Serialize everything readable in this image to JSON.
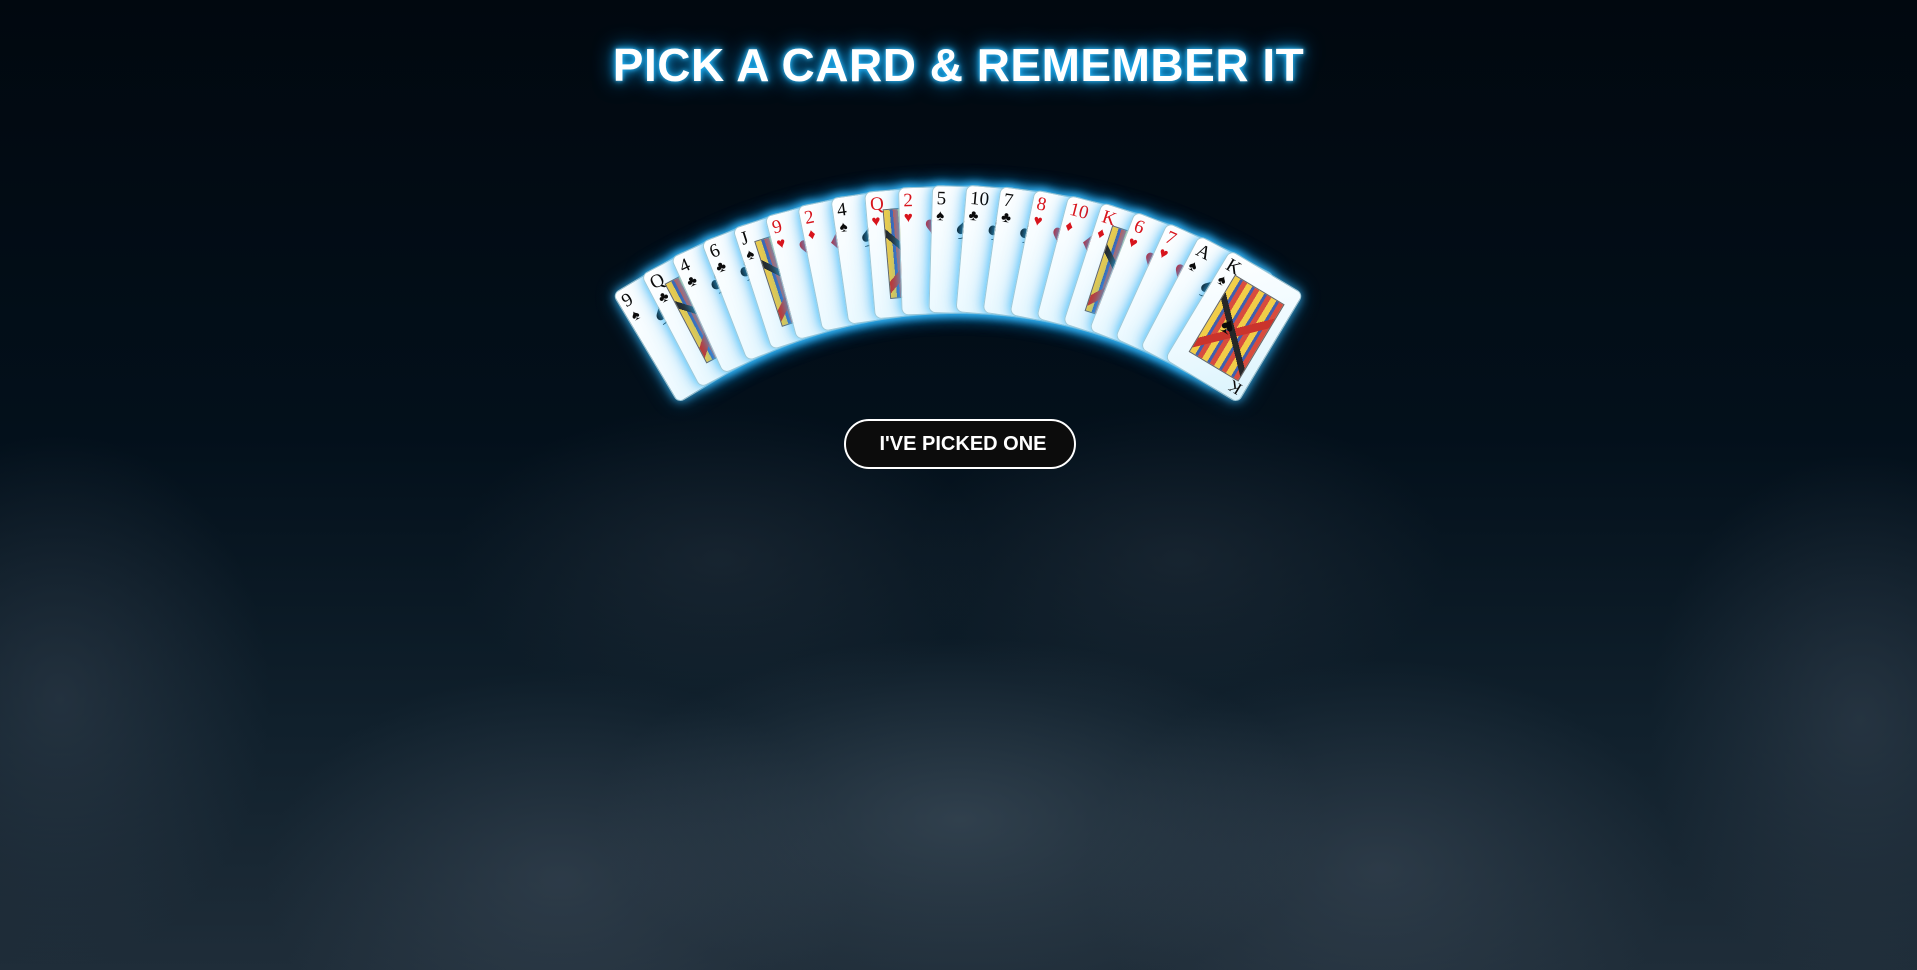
{
  "title": "PICK A CARD & REMEMBER IT",
  "button_label": "I'VE PICKED ONE",
  "colors": {
    "title_glow": "#19b7ff",
    "card_glow": "#3cbeff",
    "suit_red": "#d8141c",
    "suit_black": "#0b0b0b",
    "button_bg": "#0c0c0c",
    "button_border": "#ffffff"
  },
  "cards": [
    {
      "rank": "9",
      "suit": "♠",
      "color": "black",
      "face": false
    },
    {
      "rank": "Q",
      "suit": "♣",
      "color": "black",
      "face": true
    },
    {
      "rank": "4",
      "suit": "♣",
      "color": "black",
      "face": false
    },
    {
      "rank": "6",
      "suit": "♣",
      "color": "black",
      "face": false
    },
    {
      "rank": "J",
      "suit": "♠",
      "color": "black",
      "face": true
    },
    {
      "rank": "9",
      "suit": "♥",
      "color": "red",
      "face": false
    },
    {
      "rank": "2",
      "suit": "♦",
      "color": "red",
      "face": false
    },
    {
      "rank": "4",
      "suit": "♠",
      "color": "black",
      "face": false
    },
    {
      "rank": "Q",
      "suit": "♥",
      "color": "red",
      "face": true
    },
    {
      "rank": "2",
      "suit": "♥",
      "color": "red",
      "face": false
    },
    {
      "rank": "5",
      "suit": "♠",
      "color": "black",
      "face": false
    },
    {
      "rank": "10",
      "suit": "♣",
      "color": "black",
      "face": false
    },
    {
      "rank": "7",
      "suit": "♣",
      "color": "black",
      "face": false
    },
    {
      "rank": "8",
      "suit": "♥",
      "color": "red",
      "face": false
    },
    {
      "rank": "10",
      "suit": "♦",
      "color": "red",
      "face": false
    },
    {
      "rank": "K",
      "suit": "♦",
      "color": "red",
      "face": true
    },
    {
      "rank": "6",
      "suit": "♥",
      "color": "red",
      "face": false
    },
    {
      "rank": "7",
      "suit": "♥",
      "color": "red",
      "face": false
    },
    {
      "rank": "A",
      "suit": "♠",
      "color": "black",
      "face": false
    },
    {
      "rank": "K",
      "suit": "♠",
      "color": "black",
      "face": true
    }
  ]
}
